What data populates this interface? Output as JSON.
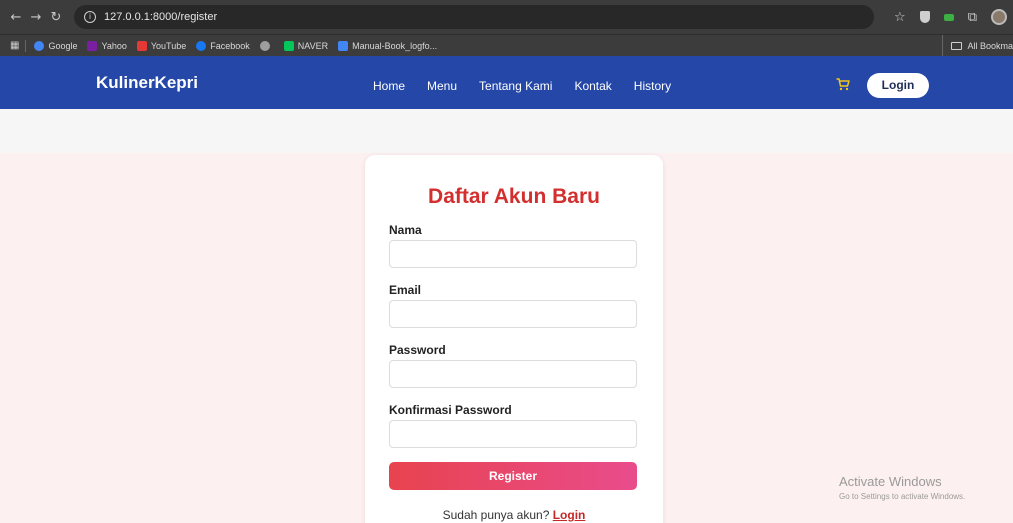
{
  "browser": {
    "url": "127.0.0.1:8000/register",
    "bookmarks": [
      {
        "label": "Google",
        "color": "#4285f4"
      },
      {
        "label": "Yahoo",
        "color": "#7b1fa2"
      },
      {
        "label": "YouTube",
        "color": "#e53935"
      },
      {
        "label": "Facebook",
        "color": "#1877f2"
      },
      {
        "label": "",
        "color": "#9e9e9e"
      },
      {
        "label": "NAVER",
        "color": "#03c75a"
      },
      {
        "label": "Manual-Book_logfo...",
        "color": "#4285f4"
      }
    ],
    "all_bookmarks_label": "All Bookma"
  },
  "navbar": {
    "brand": "KulinerKepri",
    "links": [
      "Home",
      "Menu",
      "Tentang Kami",
      "Kontak",
      "History"
    ],
    "login_label": "Login",
    "cart_icon": "cart-icon",
    "color": "#2447a8"
  },
  "form": {
    "title": "Daftar Akun Baru",
    "fields": [
      {
        "label": "Nama",
        "value": "",
        "placeholder": ""
      },
      {
        "label": "Email",
        "value": "",
        "placeholder": ""
      },
      {
        "label": "Password",
        "value": "",
        "placeholder": ""
      },
      {
        "label": "Konfirmasi Password",
        "value": "",
        "placeholder": ""
      }
    ],
    "submit_label": "Register",
    "footer_text": "Sudah punya akun?",
    "footer_link": "Login",
    "accent_color": "#d32f2f"
  },
  "watermark": {
    "title": "Activate Windows",
    "subtitle": "Go to Settings to activate Windows."
  }
}
